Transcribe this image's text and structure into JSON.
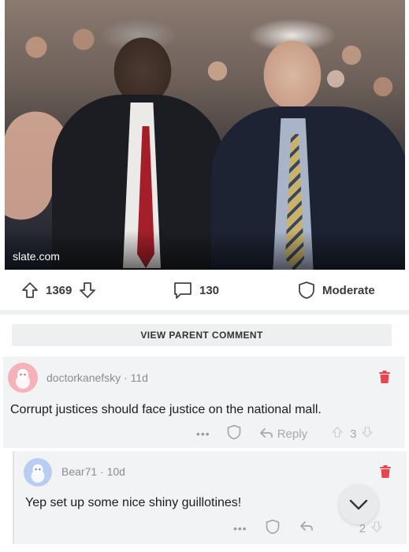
{
  "post": {
    "source": "slate.com",
    "votes": "1369",
    "comment_count": "130",
    "moderate_label": "Moderate"
  },
  "view_parent_label": "VIEW PARENT COMMENT",
  "comments": [
    {
      "username": "doctorkanefsky",
      "age": "11d",
      "text": "Corrupt justices should face justice on the national mall.",
      "reply_label": "Reply",
      "score": "3",
      "avatar_color": "#f5b2b8"
    },
    {
      "username": "Bear71",
      "age": "10d",
      "text": "Yep set up some nice shiny guillotines!",
      "score": "2",
      "avatar_color": "#b9cdf3"
    }
  ],
  "colors": {
    "delete": "#e8454f",
    "muted": "#a5a7ab"
  },
  "icons": {
    "upvote": "arrow-up-icon",
    "downvote": "arrow-down-icon",
    "comment": "speech-bubble-icon",
    "moderate": "shield-icon",
    "delete": "trash-icon",
    "more": "more-dots-icon",
    "reply": "reply-arrow-icon",
    "scroll": "chevron-down-icon"
  }
}
